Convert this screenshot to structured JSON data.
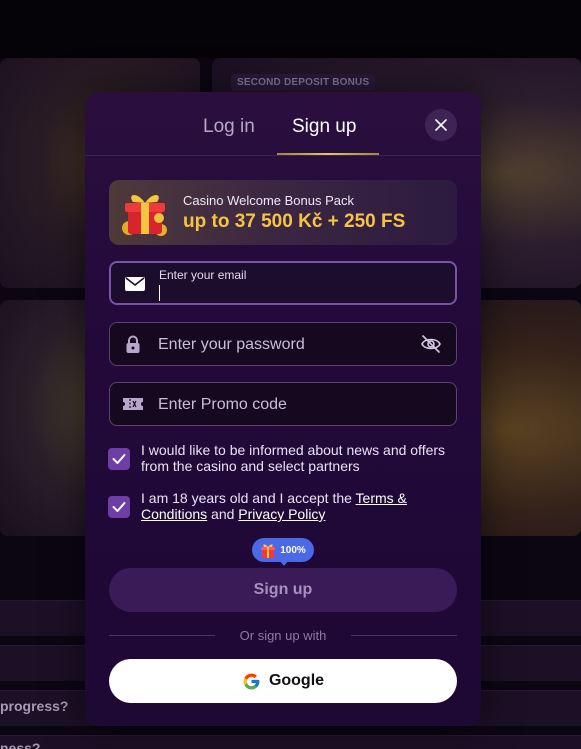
{
  "background": {
    "promo_badge": "SECOND DEPOSIT BONUS",
    "faq_items": [
      "progress?",
      "ness?"
    ]
  },
  "modal": {
    "tabs": [
      {
        "label": "Log in",
        "active": false
      },
      {
        "label": "Sign up",
        "active": true
      }
    ],
    "close_icon": "close-icon",
    "bonus": {
      "title": "Casino Welcome Bonus Pack",
      "amount": "up to 37 500 Kč + 250 FS",
      "icon": "gift-icon"
    },
    "email": {
      "label": "Enter your email",
      "value": "",
      "icon": "mail-icon"
    },
    "password": {
      "placeholder": "Enter your password",
      "icon": "lock-icon",
      "toggle_icon": "eye-off-icon"
    },
    "promo": {
      "placeholder": "Enter Promo code",
      "icon": "ticket-icon"
    },
    "consents": [
      {
        "checked": true,
        "text": "I would like to be informed about news and offers from the casino and select partners"
      },
      {
        "checked": true,
        "text_before": "I am 18 years old and I accept the ",
        "terms_link": "Terms & Conditions",
        "and_text": " and ",
        "privacy_link": "Privacy Policy"
      }
    ],
    "bonus_badge": "100%",
    "signup_button": "Sign up",
    "or_text": "Or sign up with",
    "google_button": "Google"
  },
  "colors": {
    "modal_bg": "#22093a",
    "accent_gold": "#f5c542",
    "checkbox": "#6d3fa6",
    "badge_blue": "#4b68e6"
  }
}
